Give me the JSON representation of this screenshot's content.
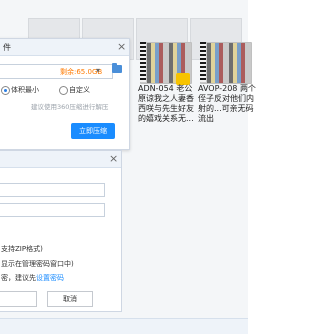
{
  "dialog": {
    "title_char": "件",
    "size_label": "剩余:65.0GB",
    "options": [
      "体积最小",
      "自定义"
    ],
    "hint": "建议使用360压缩进行解压",
    "primary_button": "立即压缩"
  },
  "files": [
    {
      "title": "ADN-054 老公原谅我之人妻香西咲与先生好友的嬉戏关系无..."
    },
    {
      "title": "AVOP-208 两个侄子反对他们内射的...可亲无码流出"
    }
  ],
  "dialog2": {
    "line1": "支持ZIP格式)",
    "line2": "显示在管理密码窗口中)",
    "line3_prefix": "密，建议先",
    "line3_link": "设置密码",
    "cancel": "取消"
  },
  "colors": {
    "accent": "#1a8cff",
    "warning": "#ff7a00",
    "badge": "#f7c300"
  }
}
